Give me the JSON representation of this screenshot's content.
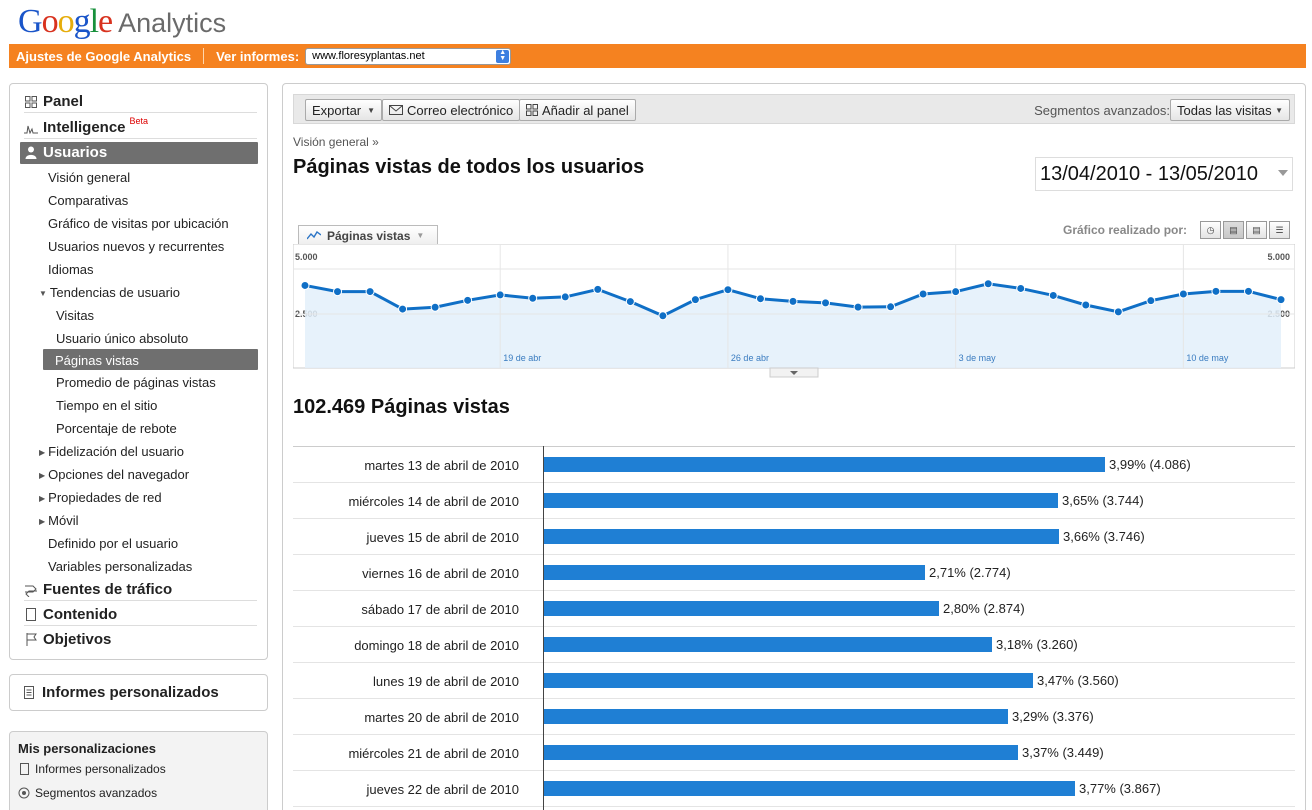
{
  "header": {
    "logo_letters": [
      "G",
      "o",
      "o",
      "g",
      "l",
      "e"
    ],
    "logo_suffix": "Analytics",
    "settings_link": "Ajustes de Google Analytics",
    "view_reports_label": "Ver informes:",
    "site_selected": "www.floresyplantas.net"
  },
  "sidebar": {
    "top": [
      {
        "label": "Panel",
        "icon": "grid-icon"
      },
      {
        "label": "Intelligence",
        "badge": "Beta",
        "icon": "spark-icon"
      },
      {
        "label": "Usuarios",
        "icon": "person-icon"
      }
    ],
    "usuarios_sub": [
      "Visión general",
      "Comparativas",
      "Gráfico de visitas por ubicación",
      "Usuarios nuevos y recurrentes",
      "Idiomas",
      "Tendencias de usuario"
    ],
    "tendencias_sub": [
      "Visitas",
      "Usuario único absoluto",
      "Páginas vistas",
      "Promedio de páginas vistas",
      "Tiempo en el sitio",
      "Porcentaje de rebote"
    ],
    "more_sub": [
      {
        "label": "Fidelización del usuario",
        "expandable": true
      },
      {
        "label": "Opciones del navegador",
        "expandable": true
      },
      {
        "label": "Propiedades de red",
        "expandable": true
      },
      {
        "label": "Móvil",
        "expandable": true
      },
      {
        "label": "Definido por el usuario",
        "expandable": false
      },
      {
        "label": "Variables personalizadas",
        "expandable": false
      }
    ],
    "bottom": [
      {
        "label": "Fuentes de tráfico",
        "icon": "traffic-icon"
      },
      {
        "label": "Contenido",
        "icon": "page-icon"
      },
      {
        "label": "Objetivos",
        "icon": "flag-icon"
      }
    ],
    "custom_reports": "Informes personalizados",
    "my_customizations": {
      "title": "Mis personalizaciones",
      "items": [
        "Informes personalizados",
        "Segmentos avanzados"
      ]
    }
  },
  "toolbar": {
    "export": "Exportar",
    "email": "Correo electrónico",
    "add_to_dashboard": "Añadir al panel",
    "segments_label": "Segmentos avanzados:",
    "segments_value": "Todas las visitas"
  },
  "content": {
    "breadcrumb": "Visión general »",
    "title": "Páginas vistas de todos los usuarios",
    "date_range": "13/04/2010 - 13/05/2010",
    "chart_tab": "Páginas vistas",
    "graph_by_label": "Gráfico realizado por:",
    "total": "102.469 Páginas vistas"
  },
  "chart_data": {
    "type": "area",
    "y_ticks": [
      "5.000",
      "2.500"
    ],
    "ylim": [
      0,
      5000
    ],
    "x_labels": [
      "19 de abr",
      "26 de abr",
      "3 de may",
      "10 de may"
    ],
    "x_label_positions": [
      6,
      13,
      20,
      27
    ],
    "values": [
      4086,
      3744,
      3746,
      2774,
      2874,
      3260,
      3560,
      3376,
      3449,
      3867,
      3190,
      2400,
      3300,
      3850,
      3350,
      3200,
      3120,
      2880,
      2900,
      3610,
      3740,
      4180,
      3920,
      3530,
      3000,
      2620,
      3240,
      3610,
      3760,
      3760,
      3300
    ],
    "grid": true
  },
  "table": {
    "max_value": 4200,
    "rows": [
      {
        "date": "martes 13 de abril de 2010",
        "value": 4086,
        "label": "3,99% (4.086)"
      },
      {
        "date": "miércoles 14 de abril de 2010",
        "value": 3744,
        "label": "3,65% (3.744)"
      },
      {
        "date": "jueves 15 de abril de 2010",
        "value": 3746,
        "label": "3,66% (3.746)"
      },
      {
        "date": "viernes 16 de abril de 2010",
        "value": 2774,
        "label": "2,71% (2.774)"
      },
      {
        "date": "sábado 17 de abril de 2010",
        "value": 2874,
        "label": "2,80% (2.874)"
      },
      {
        "date": "domingo 18 de abril de 2010",
        "value": 3260,
        "label": "3,18% (3.260)"
      },
      {
        "date": "lunes 19 de abril de 2010",
        "value": 3560,
        "label": "3,47% (3.560)"
      },
      {
        "date": "martes 20 de abril de 2010",
        "value": 3376,
        "label": "3,29% (3.376)"
      },
      {
        "date": "miércoles 21 de abril de 2010",
        "value": 3449,
        "label": "3,37% (3.449)"
      },
      {
        "date": "jueves 22 de abril de 2010",
        "value": 3867,
        "label": "3,77% (3.867)"
      }
    ]
  },
  "colors": {
    "orange": "#f58220",
    "bar_blue": "#1f7fd4",
    "line_blue": "#0f6fc6",
    "area_fill": "#e3f0fa"
  }
}
